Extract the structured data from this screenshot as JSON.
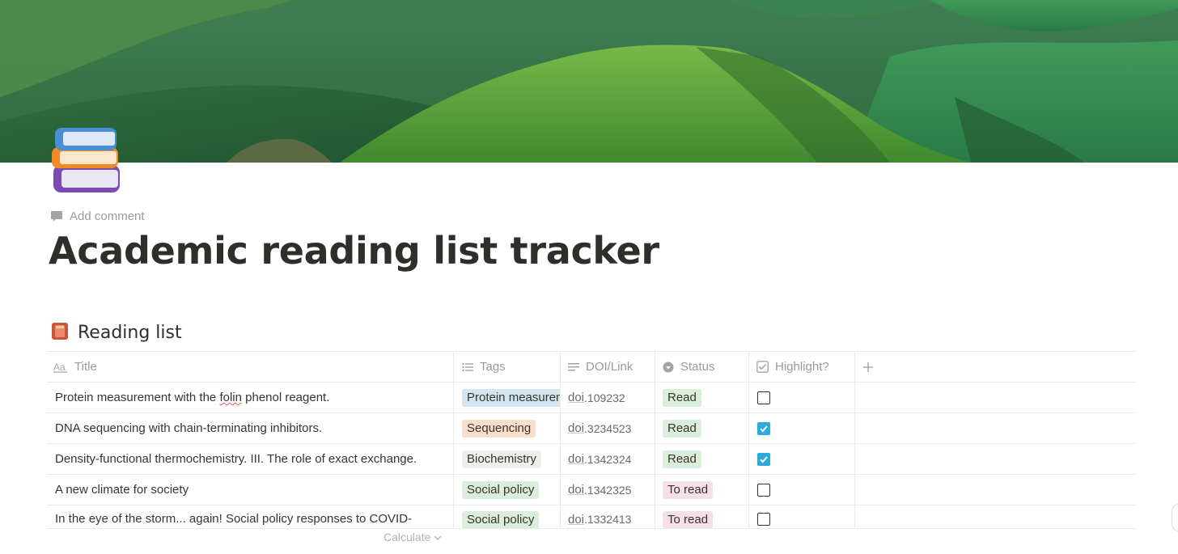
{
  "page": {
    "add_comment": "Add comment",
    "title": "Academic reading list tracker",
    "icon": "books-emoji-icon"
  },
  "database": {
    "icon": "red-book-icon",
    "title": "Reading list",
    "columns": [
      {
        "label": "Title",
        "icon": "title-aa-icon"
      },
      {
        "label": "Tags",
        "icon": "multi-select-list-icon"
      },
      {
        "label": "DOI/Link",
        "icon": "text-lines-icon"
      },
      {
        "label": "Status",
        "icon": "status-icon"
      },
      {
        "label": "Highlight?",
        "icon": "checkbox-icon"
      },
      {
        "label": "",
        "icon": "plus-icon"
      }
    ],
    "rows": [
      {
        "title_before": "Protein measurement with the ",
        "title_misspelled": "folin",
        "title_after": " phenol reagent.",
        "tag": "Protein measurement",
        "doi_prefix": "doi",
        "doi_number": ".109232",
        "status": "Read",
        "highlight": false
      },
      {
        "title_before": "DNA sequencing with chain-terminating inhibitors.",
        "title_misspelled": "",
        "title_after": "",
        "tag": "Sequencing",
        "doi_prefix": "doi",
        "doi_number": ".3234523",
        "status": "Read",
        "highlight": true
      },
      {
        "title_before": "Density-functional thermochemistry. III. The role of exact exchange.",
        "title_misspelled": "",
        "title_after": "",
        "tag": "Biochemistry",
        "doi_prefix": "doi",
        "doi_number": ".1342324",
        "status": "Read",
        "highlight": true
      },
      {
        "title_before": "A new climate for society",
        "title_misspelled": "",
        "title_after": "",
        "tag": "Social policy",
        "doi_prefix": "doi",
        "doi_number": ".1342325",
        "status": "To read",
        "highlight": false
      },
      {
        "title_before": "In the eye of the storm... again! Social policy responses to COVID-",
        "title_misspelled": "",
        "title_after": "",
        "tag": "Social policy",
        "doi_prefix": "doi",
        "doi_number": ".1332413",
        "status": "To read",
        "highlight": false
      }
    ],
    "calculate": "Calculate",
    "colors": {
      "tag_protein": "#d3e5ef",
      "tag_sequencing": "#fadec9",
      "tag_biochemistry": "#eeeeec",
      "tag_social": "#dbeddb",
      "status_read": "#dbeddb",
      "status_to_read": "#f5e0e9",
      "checkbox_checked": "#2eaadc"
    }
  }
}
